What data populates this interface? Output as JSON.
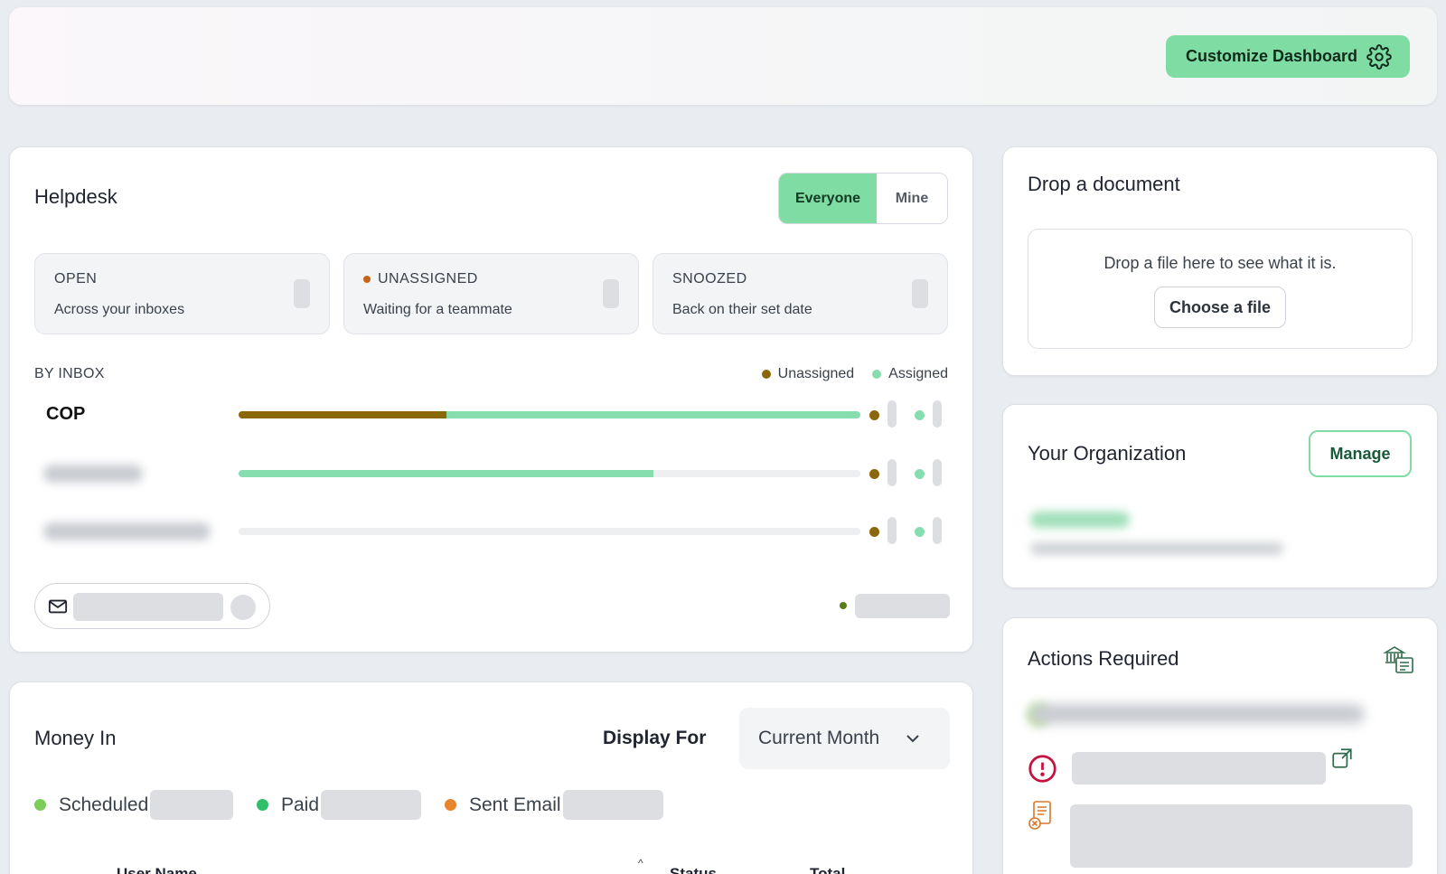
{
  "header": {
    "customize_label": "Customize Dashboard",
    "customize_icon": "gear-icon"
  },
  "helpdesk": {
    "title": "Helpdesk",
    "toggle": {
      "options": [
        "Everyone",
        "Mine"
      ],
      "selected": "Everyone"
    },
    "stats": [
      {
        "label": "OPEN",
        "sub": "Across your inboxes",
        "has_dot": false
      },
      {
        "label": "UNASSIGNED",
        "sub": "Waiting for a teammate",
        "has_dot": true,
        "dot_color": "#c8641a"
      },
      {
        "label": "SNOOZED",
        "sub": "Back on their set date",
        "has_dot": false
      }
    ],
    "by_inbox_label": "BY INBOX",
    "legend": [
      {
        "label": "Unassigned",
        "color": "#8a6708"
      },
      {
        "label": "Assigned",
        "color": "#86ddae"
      }
    ],
    "inboxes": [
      {
        "name": "COP",
        "blurred": false,
        "unassigned_fraction": 0.335,
        "assigned_fraction": 0.665
      },
      {
        "name": "",
        "blurred": true,
        "unassigned_fraction": 0.0,
        "assigned_fraction": 0.667
      },
      {
        "name": "",
        "blurred": true,
        "unassigned_fraction": 0.0,
        "assigned_fraction": 0.0
      }
    ]
  },
  "money_in": {
    "title": "Money In",
    "display_for_label": "Display For",
    "period_selected": "Current Month",
    "legend": [
      {
        "label": "Scheduled",
        "color": "#7dcc5a"
      },
      {
        "label": "Paid",
        "color": "#2fbf6a"
      },
      {
        "label": "Sent Email",
        "color": "#e8842c"
      }
    ],
    "columns": [
      "User Name",
      "Status",
      "Total"
    ]
  },
  "drop_doc": {
    "title": "Drop a document",
    "hint": "Drop a file here to see what it is.",
    "button_label": "Choose a file"
  },
  "organization": {
    "title": "Your Organization",
    "manage_label": "Manage"
  },
  "actions": {
    "title": "Actions Required"
  },
  "colors": {
    "accent": "#7fdca2",
    "unassigned": "#8a6708",
    "assigned": "#86ddae",
    "alert": "#c8103e"
  }
}
